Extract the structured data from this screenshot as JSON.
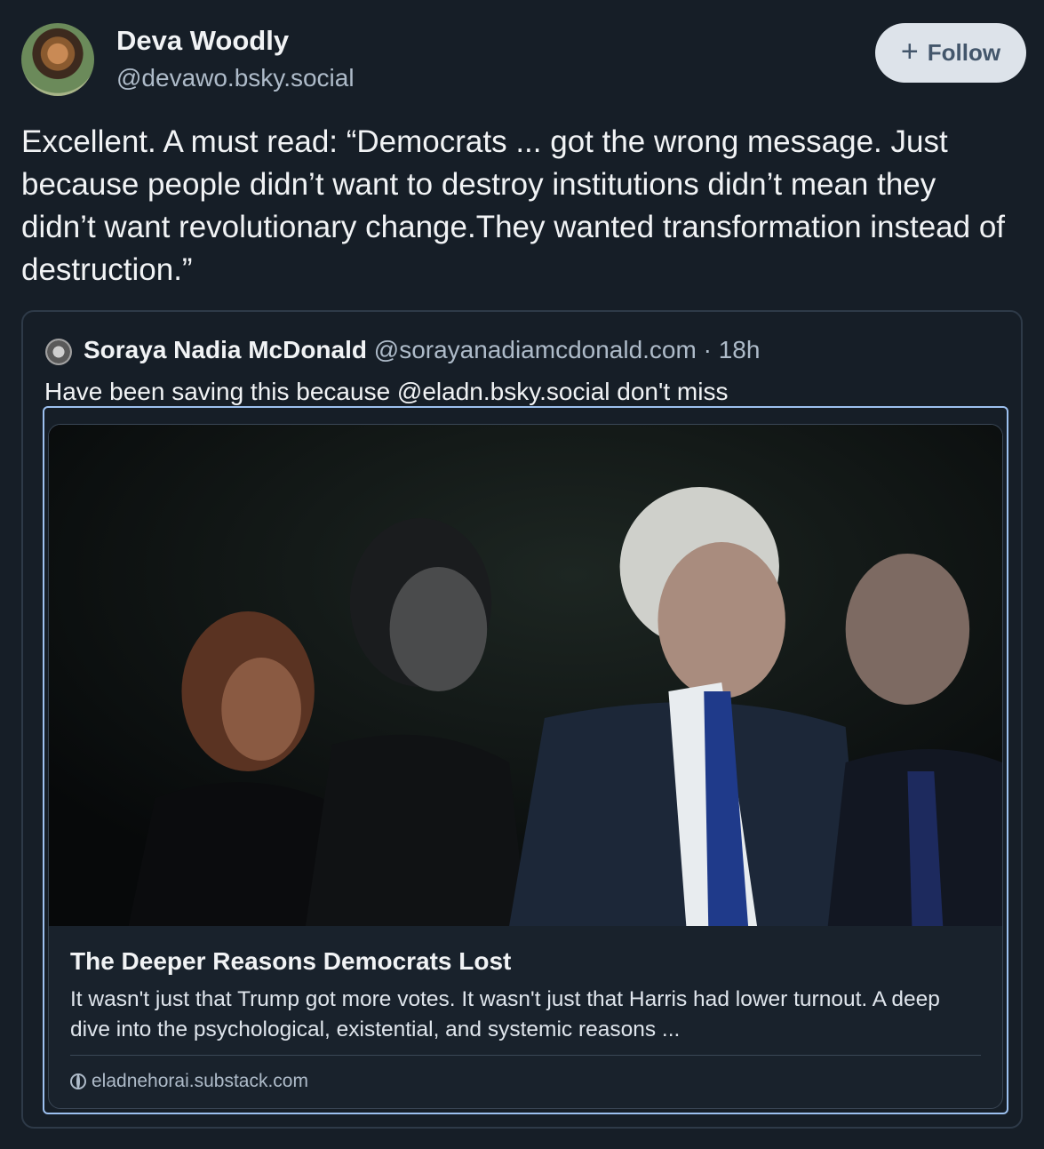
{
  "author": {
    "name": "Deva Woodly",
    "handle": "@devawo.bsky.social"
  },
  "follow_button": {
    "icon": "+",
    "label": "Follow"
  },
  "post": {
    "text": "Excellent. A must read: “Democrats ... got the wrong message. Just because people didn’t want to destroy institutions didn’t mean they didn’t want revolutionary change.They wanted transformation instead of destruction.”"
  },
  "quoted_post": {
    "author_name": "Soraya Nadia McDonald",
    "author_handle": "@sorayanadiamcdonald.com",
    "separator": " · ",
    "time": "18h",
    "text": "Have been saving this because @eladn.bsky.social don't miss"
  },
  "link_card": {
    "image_description": "photo",
    "title": "The Deeper Reasons Democrats Lost",
    "description": "It wasn't just that Trump got more votes. It wasn't just that Harris had lower turnout. A deep dive into the psychological, existential, and systemic reasons ...",
    "domain": "eladnehorai.substack.com"
  },
  "colors": {
    "background": "#161e27",
    "follow_bg": "#dde3ea",
    "link_border": "#9cc0ef",
    "muted_text": "#aebbc9"
  }
}
